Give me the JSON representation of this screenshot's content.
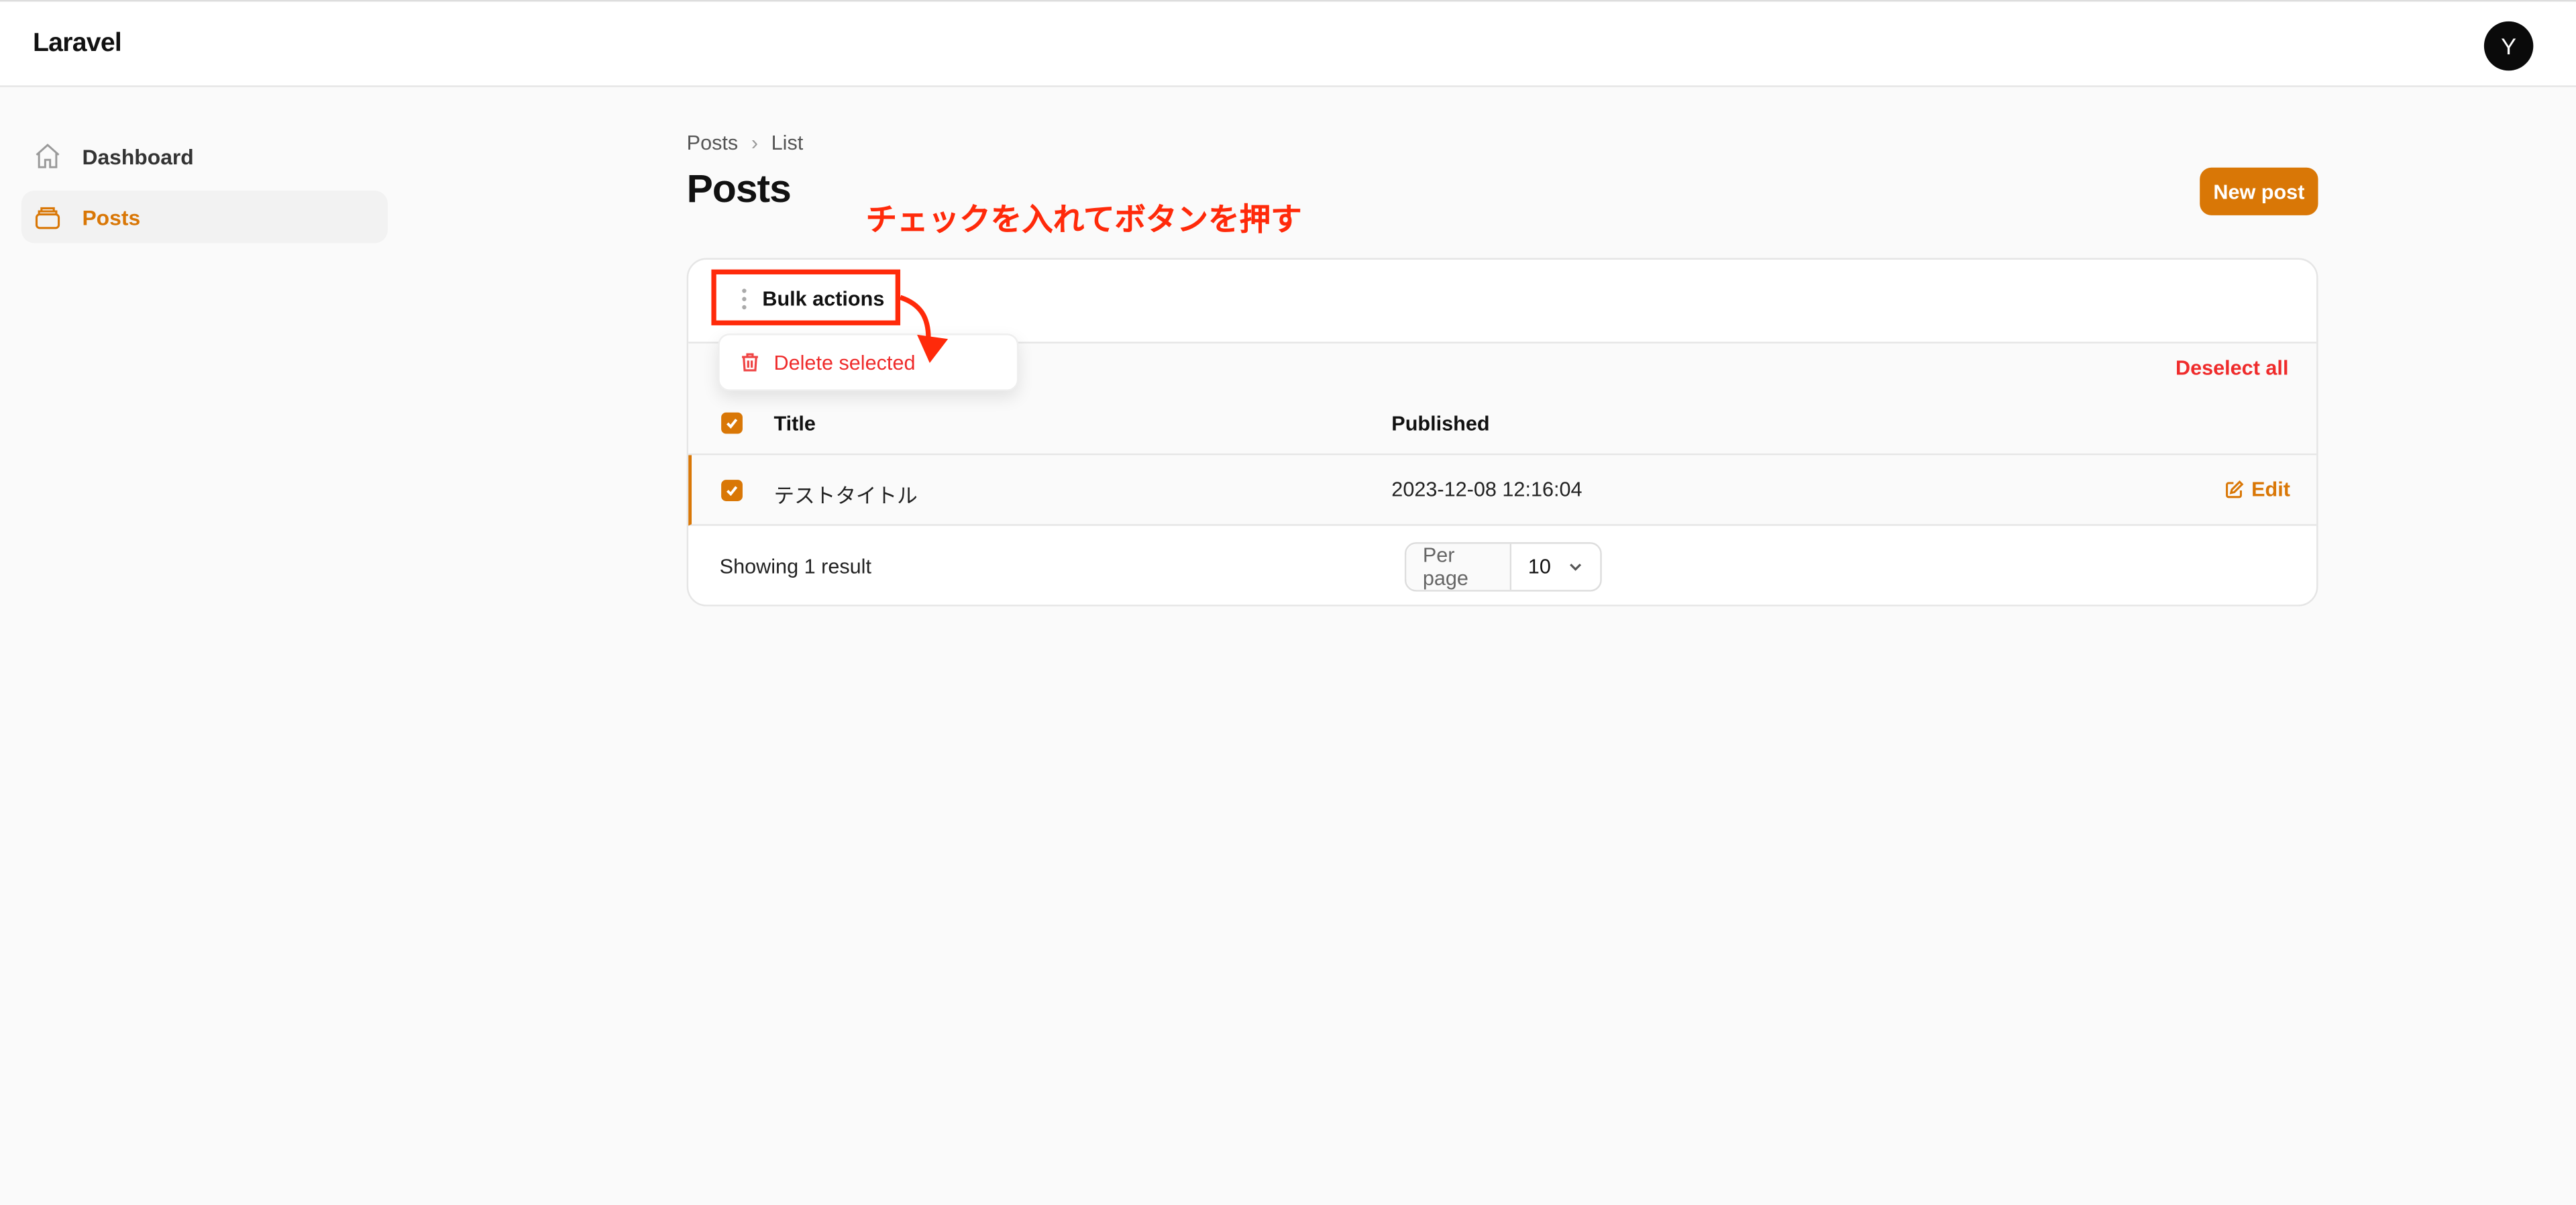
{
  "app": {
    "title": "Laravel",
    "avatar_initial": "Y"
  },
  "sidebar": {
    "items": [
      {
        "label": "Dashboard",
        "icon": "home-icon",
        "active": false
      },
      {
        "label": "Posts",
        "icon": "archive-icon",
        "active": true
      }
    ]
  },
  "breadcrumb": [
    "Posts",
    "List"
  ],
  "page_title": "Posts",
  "annotation": "チェックを入れてボタンを押す",
  "new_post_label": "New post",
  "table": {
    "bulk_actions_label": "Bulk actions",
    "bulk_menu": [
      {
        "label": "Delete selected",
        "icon": "trash-icon"
      }
    ],
    "deselect_all_label": "Deselect all",
    "columns": [
      "Title",
      "Published"
    ],
    "rows": [
      {
        "title": "テストタイトル",
        "published": "2023-12-08 12:16:04",
        "action": "Edit",
        "selected": true
      }
    ],
    "summary": "Showing 1 result",
    "per_page_label": "Per page",
    "per_page_value": "10"
  },
  "colors": {
    "accent": "#d97706",
    "danger": "#ef2b2b",
    "annotation": "#ff2a0a"
  }
}
